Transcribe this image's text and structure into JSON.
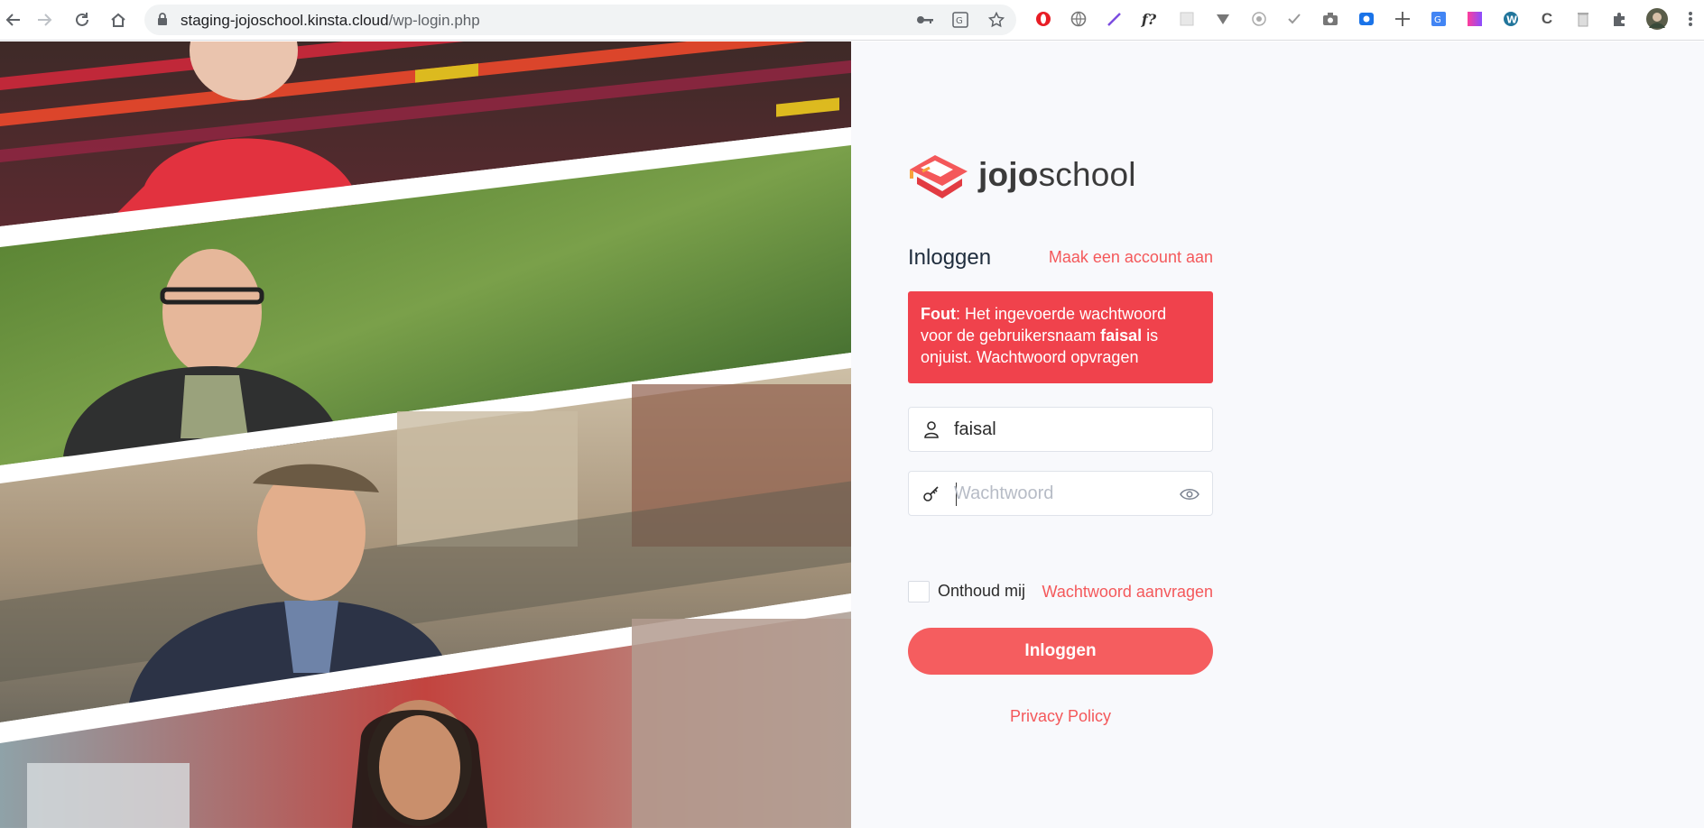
{
  "browser": {
    "url_host": "staging-jojoschool.kinsta.cloud",
    "url_path": "/wp-login.php",
    "extension_icons": [
      "opera-icon",
      "globe-icon",
      "pen-icon",
      "font-icon",
      "grid-icon",
      "vimeo-icon",
      "target-icon",
      "check-icon",
      "camera-icon",
      "screen-record-icon",
      "move-icon",
      "translate-icon",
      "gradient-icon",
      "wordpress-icon",
      "c-icon",
      "trash-icon",
      "puzzle-icon",
      "avatar"
    ],
    "font_ext_label": "f?"
  },
  "logo": {
    "bold": "jojo",
    "regular": "school"
  },
  "login": {
    "heading": "Inloggen",
    "register_link": "Maak een account aan",
    "error": {
      "prefix": "Fout",
      "text1": ": Het ingevoerde wachtwoord voor de gebruikersnaam ",
      "username": "faisal",
      "text2": " is onjuist. Wachtwoord opvragen"
    },
    "username_value": "faisal",
    "password_placeholder": "Wachtwoord",
    "remember_label": "Onthoud mij",
    "lost_password": "Wachtwoord aanvragen",
    "submit_label": "Inloggen",
    "privacy": "Privacy Policy"
  },
  "colors": {
    "accent": "#f4585a",
    "error_bg": "#f0424c",
    "panel_bg": "#f8f9fc"
  }
}
